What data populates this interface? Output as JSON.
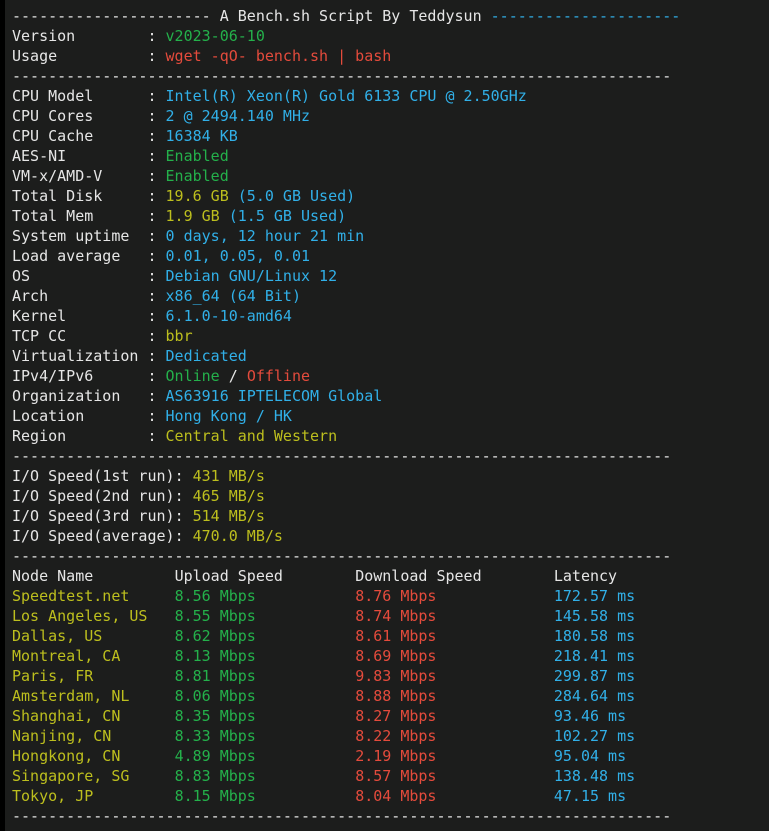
{
  "terminal": {
    "title_line": {
      "left_dashes": "----------------------",
      "title": " A Bench.sh Script By Teddysun ",
      "right_dashes": "---------------------"
    },
    "separator": "-------------------------------------------------------------------------",
    "colon": ":"
  },
  "script_info": [
    {
      "label": "Version",
      "value": "v2023-06-10",
      "color": "green"
    },
    {
      "label": "Usage",
      "value": "wget -qO- bench.sh | bash",
      "color": "red"
    }
  ],
  "system_info": [
    {
      "label": "CPU Model",
      "value": "Intel(R) Xeon(R) Gold 6133 CPU @ 2.50GHz",
      "color": "cyan"
    },
    {
      "label": "CPU Cores",
      "value": "2 @ 2494.140 MHz",
      "color": "cyan"
    },
    {
      "label": "CPU Cache",
      "value": "16384 KB",
      "color": "cyan"
    },
    {
      "label": "AES-NI",
      "value": "Enabled",
      "color": "green"
    },
    {
      "label": "VM-x/AMD-V",
      "value": "Enabled",
      "color": "green"
    },
    {
      "label": "Total Disk",
      "value": "19.6 GB",
      "value2": " (5.0 GB Used)",
      "color": "yellow",
      "color2": "cyan"
    },
    {
      "label": "Total Mem",
      "value": "1.9 GB",
      "value2": " (1.5 GB Used)",
      "color": "yellow",
      "color2": "cyan"
    },
    {
      "label": "System uptime",
      "value": "0 days, 12 hour 21 min",
      "color": "cyan"
    },
    {
      "label": "Load average",
      "value": "0.01, 0.05, 0.01",
      "color": "cyan"
    },
    {
      "label": "OS",
      "value": "Debian GNU/Linux 12",
      "color": "cyan"
    },
    {
      "label": "Arch",
      "value": "x86_64 (64 Bit)",
      "color": "cyan"
    },
    {
      "label": "Kernel",
      "value": "6.1.0-10-amd64",
      "color": "cyan"
    },
    {
      "label": "TCP CC",
      "value": "bbr",
      "color": "yellow"
    },
    {
      "label": "Virtualization",
      "value": "Dedicated",
      "color": "cyan"
    },
    {
      "label": "IPv4/IPv6",
      "value": "Online",
      "sep": " / ",
      "value2": "Offline",
      "color": "green",
      "color2": "red"
    },
    {
      "label": "Organization",
      "value": "AS63916 IPTELECOM Global",
      "color": "cyan"
    },
    {
      "label": "Location",
      "value": "Hong Kong / HK",
      "color": "cyan"
    },
    {
      "label": "Region",
      "value": "Central and Western",
      "color": "yellow"
    }
  ],
  "io_speed": [
    {
      "label": "I/O Speed(1st run)",
      "value": "431 MB/s"
    },
    {
      "label": "I/O Speed(2nd run)",
      "value": "465 MB/s"
    },
    {
      "label": "I/O Speed(3rd run)",
      "value": "514 MB/s"
    },
    {
      "label": "I/O Speed(average)",
      "value": "470.0 MB/s"
    }
  ],
  "speedtest": {
    "headers": [
      "Node Name",
      "Upload Speed",
      "Download Speed",
      "Latency"
    ],
    "rows": [
      {
        "node": "Speedtest.net",
        "upload": "8.56 Mbps",
        "download": "8.76 Mbps",
        "latency": "172.57 ms"
      },
      {
        "node": "Los Angeles, US",
        "upload": "8.55 Mbps",
        "download": "8.74 Mbps",
        "latency": "145.58 ms"
      },
      {
        "node": "Dallas, US",
        "upload": "8.62 Mbps",
        "download": "8.61 Mbps",
        "latency": "180.58 ms"
      },
      {
        "node": "Montreal, CA",
        "upload": "8.13 Mbps",
        "download": "8.69 Mbps",
        "latency": "218.41 ms"
      },
      {
        "node": "Paris, FR",
        "upload": "8.81 Mbps",
        "download": "9.83 Mbps",
        "latency": "299.87 ms"
      },
      {
        "node": "Amsterdam, NL",
        "upload": "8.06 Mbps",
        "download": "8.88 Mbps",
        "latency": "284.64 ms"
      },
      {
        "node": "Shanghai, CN",
        "upload": "8.35 Mbps",
        "download": "8.27 Mbps",
        "latency": "93.46 ms"
      },
      {
        "node": "Nanjing, CN",
        "upload": "8.33 Mbps",
        "download": "8.22 Mbps",
        "latency": "102.27 ms"
      },
      {
        "node": "Hongkong, CN",
        "upload": "4.89 Mbps",
        "download": "2.19 Mbps",
        "latency": "95.04 ms"
      },
      {
        "node": "Singapore, SG",
        "upload": "8.83 Mbps",
        "download": "8.57 Mbps",
        "latency": "138.48 ms"
      },
      {
        "node": "Tokyo, JP",
        "upload": "8.15 Mbps",
        "download": "8.04 Mbps",
        "latency": "47.15 ms"
      }
    ]
  },
  "colors": {
    "background": "#1c1d1c",
    "white": "#e6e6e6",
    "green": "#24b14b",
    "red": "#e44b3c",
    "cyan": "#31b0e8",
    "yellow": "#bdbf1e"
  }
}
